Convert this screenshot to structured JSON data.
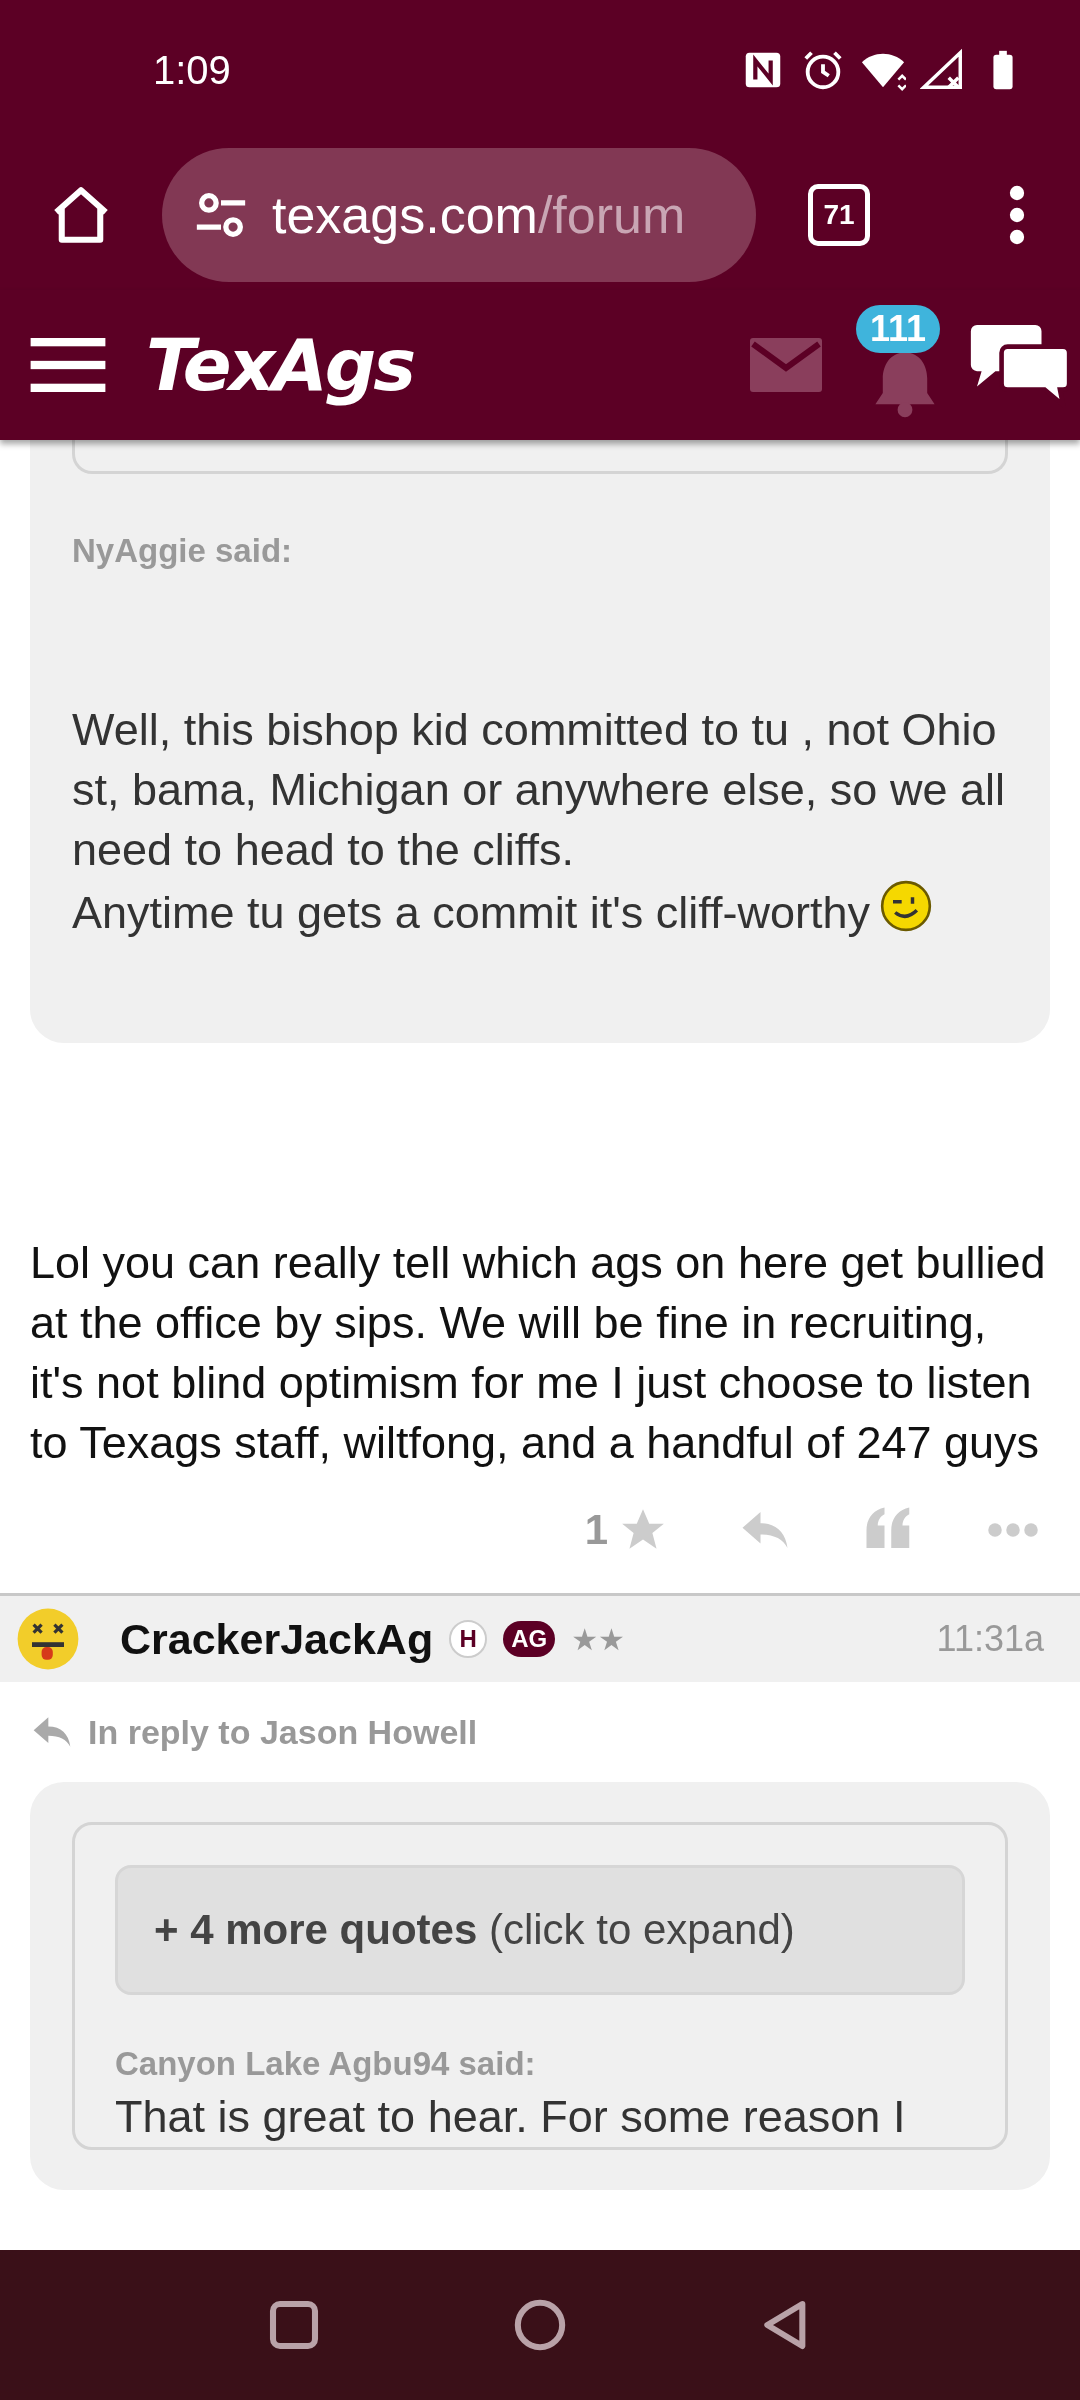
{
  "status_bar": {
    "time": "1:09"
  },
  "browser": {
    "url_host": "texags.com",
    "url_path": "/forum",
    "tab_count": "71"
  },
  "site_header": {
    "logo": "TexAgs",
    "notification_count": "111"
  },
  "posts": [
    {
      "quote": {
        "author_line": "NyAggie said:",
        "paragraphs": [
          "Well, this bishop kid committed to tu , not Ohio st, bama, Michigan or anywhere else, so we all need to head to the cliffs.",
          "Anytime tu gets a commit it's cliff-worthy"
        ],
        "ends_with_emoji": true
      },
      "body": "Lol you can really tell which ags on here get bullied at the office by sips. We will be fine in recruiting, it's not blind optimism for me I just choose to listen to Texags staff, wiltfong, and a handful of 247 guys",
      "star_count": "1"
    },
    {
      "user": {
        "name": "CrackerJackAg",
        "badges": [
          {
            "label": "H",
            "kind": "outline"
          },
          {
            "label": "AG",
            "kind": "filled"
          }
        ],
        "rank": "★★",
        "time": "11:31a"
      },
      "reply_to": "In reply to Jason Howell",
      "quote": {
        "more_quotes": "**+ 4 more quotes** (click to expand)",
        "author_line": "Canyon Lake Agbu94 said:",
        "paragraphs": [
          "That is great to hear. For some reason I"
        ]
      }
    }
  ]
}
